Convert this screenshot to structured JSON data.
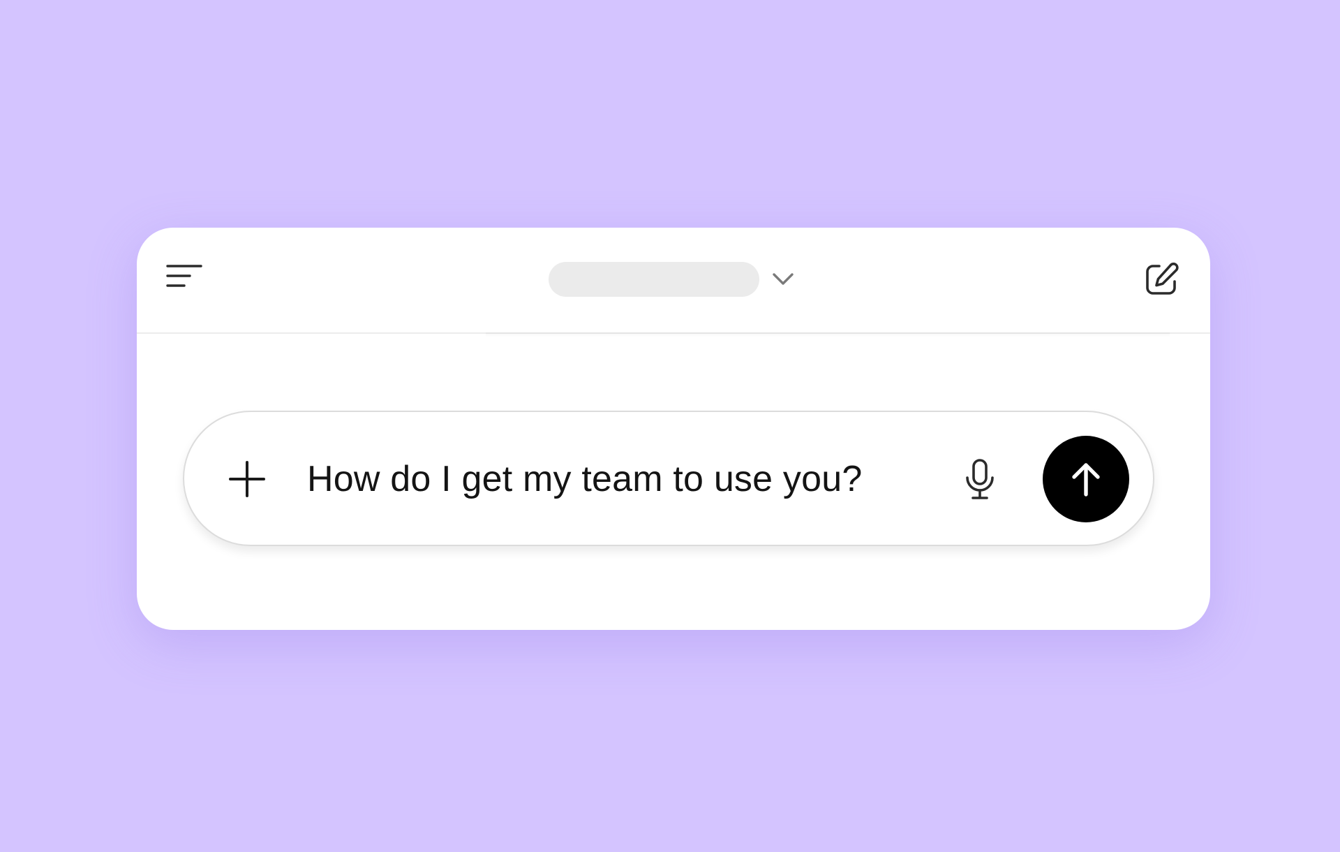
{
  "colors": {
    "background": "#d4c4ff",
    "window": "#ffffff",
    "model_placeholder": "#ebebeb",
    "send_button": "#000000",
    "icon": "#2b2b2b"
  },
  "header": {
    "menu_icon": "sidebar-menu-icon",
    "model_selector_label": "",
    "chevron_icon": "chevron-down-icon",
    "new_chat_icon": "edit-compose-icon"
  },
  "composer": {
    "add_icon": "plus-icon",
    "text": "How do I get my team to use you?",
    "mic_icon": "microphone-icon",
    "send_icon": "arrow-up-icon"
  }
}
